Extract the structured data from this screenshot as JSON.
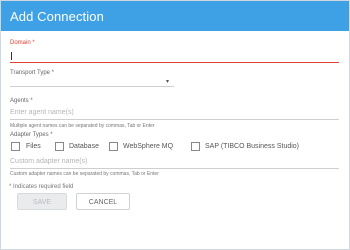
{
  "dialog": {
    "title": "Add Connection"
  },
  "form": {
    "domain": {
      "label": "Domain *",
      "value": ""
    },
    "transport_type": {
      "label": "Transport Type *",
      "value": "",
      "arrow": "▾"
    },
    "agents": {
      "label": "Agents *",
      "placeholder": "Enter agent name(s)",
      "hint": "Multiple agent names can be separated by commas, Tab or Enter"
    },
    "adapter_types": {
      "label": "Adapter Types *",
      "options": [
        {
          "label": "Files",
          "checked": false
        },
        {
          "label": "Database",
          "checked": false
        },
        {
          "label": "WebSphere MQ",
          "checked": false
        },
        {
          "label": "SAP (TIBCO Business Studio)",
          "checked": false
        }
      ]
    },
    "custom_adapter": {
      "placeholder": "Custom adapter name(s)",
      "hint": "Custom adapter names can be separated by commas, Tab or Enter"
    },
    "required_note": "* Indicates required field"
  },
  "buttons": {
    "save_label": "SAVE",
    "cancel_label": "CANCEL"
  },
  "colors": {
    "header": "#3ea1e6",
    "error": "#e0402f"
  }
}
